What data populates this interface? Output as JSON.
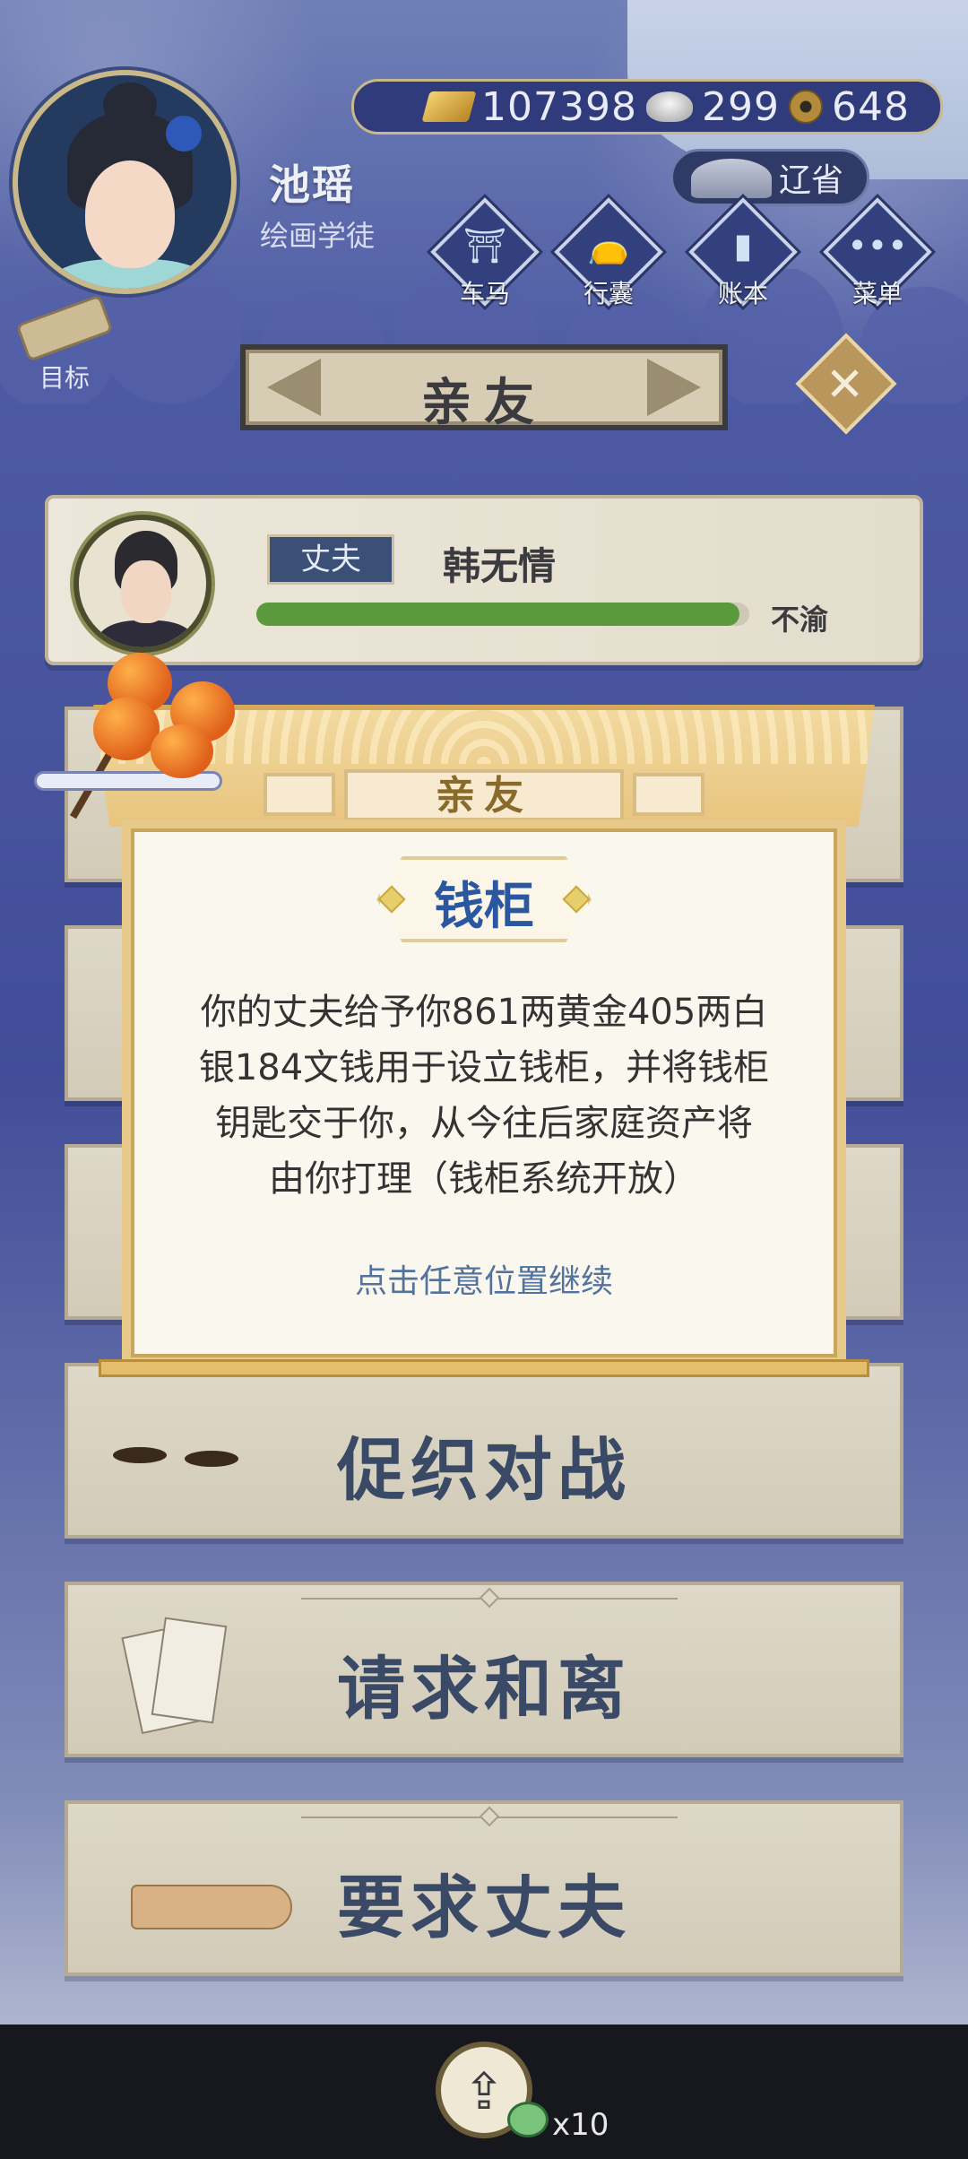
{
  "player": {
    "name": "池瑶",
    "rank": "绘画学徒"
  },
  "currency": {
    "gold": "107398",
    "silver": "299",
    "coins": "648"
  },
  "liaosheng_label": "辽省",
  "menu": [
    {
      "label": "车马",
      "icon": "carriage-icon"
    },
    {
      "label": "行囊",
      "icon": "bag-icon"
    },
    {
      "label": "账本",
      "icon": "ledger-icon"
    },
    {
      "label": "菜单",
      "icon": "more-icon"
    }
  ],
  "goal_label": "目标",
  "page_title": "亲友",
  "spouse": {
    "role": "丈夫",
    "name": "韩无情",
    "mood": "不渝",
    "affection_fraction": 0.98
  },
  "actions": [
    {
      "label": "促织对战",
      "icon": "cricket-icon"
    },
    {
      "label": "请求和离",
      "icon": "divorce-letter-icon"
    },
    {
      "label": "要求丈夫",
      "icon": "pointing-hand-icon"
    }
  ],
  "modal": {
    "tab_label": "亲友",
    "heading": "钱柜",
    "line1": "你的丈夫给予你861两黄金405两白",
    "line2": "银184文钱用于设立钱柜，并将钱柜",
    "line3": "钥匙交于你，从今往后家庭资产将",
    "line4": "由你打理（钱柜系统开放）",
    "hint": "点击任意位置继续"
  },
  "bottom": {
    "share_icon": "share-icon",
    "count": "x10"
  },
  "colors": {
    "accent_blue": "#2b57a0",
    "gold_frame": "#e7c98a",
    "bar_green": "#5a9a3d"
  }
}
